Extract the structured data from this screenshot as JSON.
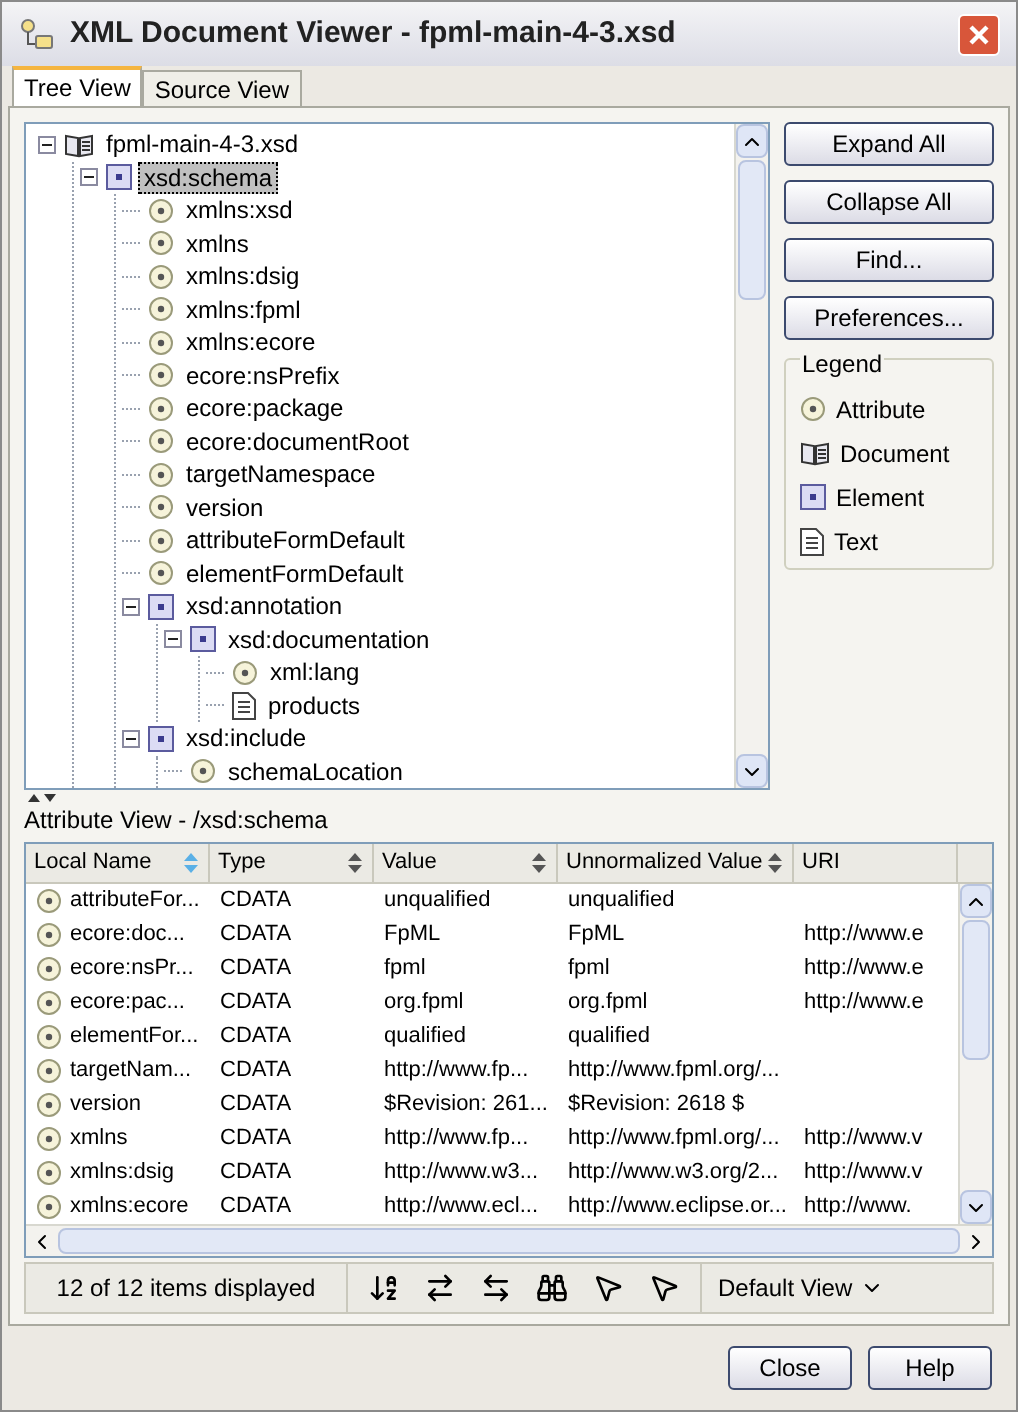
{
  "window": {
    "title": "XML Document Viewer - fpml-main-4-3.xsd"
  },
  "tabs": [
    {
      "label": "Tree View",
      "selected": true
    },
    {
      "label": "Source View",
      "selected": false
    }
  ],
  "tree": [
    {
      "label": "fpml-main-4-3.xsd",
      "kind": "document",
      "expanded": true,
      "selected": false,
      "children": [
        {
          "label": "xsd:schema",
          "kind": "element",
          "expanded": true,
          "selected": true,
          "children": [
            {
              "label": "xmlns:xsd",
              "kind": "attribute",
              "selected": false
            },
            {
              "label": "xmlns",
              "kind": "attribute",
              "selected": false
            },
            {
              "label": "xmlns:dsig",
              "kind": "attribute",
              "selected": false
            },
            {
              "label": "xmlns:fpml",
              "kind": "attribute",
              "selected": false
            },
            {
              "label": "xmlns:ecore",
              "kind": "attribute",
              "selected": false
            },
            {
              "label": "ecore:nsPrefix",
              "kind": "attribute",
              "selected": false
            },
            {
              "label": "ecore:package",
              "kind": "attribute",
              "selected": false
            },
            {
              "label": "ecore:documentRoot",
              "kind": "attribute",
              "selected": false
            },
            {
              "label": "targetNamespace",
              "kind": "attribute",
              "selected": false
            },
            {
              "label": "version",
              "kind": "attribute",
              "selected": false
            },
            {
              "label": "attributeFormDefault",
              "kind": "attribute",
              "selected": false
            },
            {
              "label": "elementFormDefault",
              "kind": "attribute",
              "selected": false
            },
            {
              "label": "xsd:annotation",
              "kind": "element",
              "expanded": true,
              "selected": false,
              "children": [
                {
                  "label": "xsd:documentation",
                  "kind": "element",
                  "expanded": true,
                  "selected": false,
                  "children": [
                    {
                      "label": "xml:lang",
                      "kind": "attribute",
                      "selected": false
                    },
                    {
                      "label": "products",
                      "kind": "text",
                      "selected": false
                    }
                  ]
                }
              ]
            },
            {
              "label": "xsd:include",
              "kind": "element",
              "expanded": true,
              "selected": false,
              "children": [
                {
                  "label": "schemaLocation",
                  "kind": "attribute",
                  "selected": false
                }
              ]
            }
          ]
        }
      ]
    }
  ],
  "buttons": [
    "Expand All",
    "Collapse All",
    "Find...",
    "Preferences..."
  ],
  "legend": {
    "title": "Legend",
    "items": [
      {
        "label": "Attribute",
        "kind": "attribute"
      },
      {
        "label": "Document",
        "kind": "document"
      },
      {
        "label": "Element",
        "kind": "element"
      },
      {
        "label": "Text",
        "kind": "text"
      }
    ]
  },
  "attribute_view": {
    "title": "Attribute View - /xsd:schema",
    "columns": [
      {
        "label": "Local Name",
        "sorted": true
      },
      {
        "label": "Type",
        "sorted": false
      },
      {
        "label": "Value",
        "sorted": false
      },
      {
        "label": "Unnormalized Value",
        "sorted": false
      },
      {
        "label": "URI"
      }
    ],
    "rows": [
      [
        "attributeFor...",
        "CDATA",
        "unqualified",
        "unqualified",
        ""
      ],
      [
        "ecore:doc...",
        "CDATA",
        "FpML",
        "FpML",
        "http://www.e"
      ],
      [
        "ecore:nsPr...",
        "CDATA",
        "fpml",
        "fpml",
        "http://www.e"
      ],
      [
        "ecore:pac...",
        "CDATA",
        "org.fpml",
        "org.fpml",
        "http://www.e"
      ],
      [
        "elementFor...",
        "CDATA",
        "qualified",
        "qualified",
        ""
      ],
      [
        "targetNam...",
        "CDATA",
        "http://www.fp...",
        "http://www.fpml.org/...",
        ""
      ],
      [
        "version",
        "CDATA",
        "$Revision: 261...",
        "$Revision: 2618 $",
        ""
      ],
      [
        "xmlns",
        "CDATA",
        "http://www.fp...",
        "http://www.fpml.org/...",
        "http://www.v"
      ],
      [
        "xmlns:dsig",
        "CDATA",
        "http://www.w3...",
        "http://www.w3.org/2...",
        "http://www.v"
      ],
      [
        "xmlns:ecore",
        "CDATA",
        "http://www.ecl...",
        "http://www.eclipse.or...",
        "http://www."
      ]
    ]
  },
  "status_bar": {
    "count": "12 of 12 items displayed",
    "view": "Default View"
  },
  "footer_buttons": [
    "Close",
    "Help"
  ]
}
